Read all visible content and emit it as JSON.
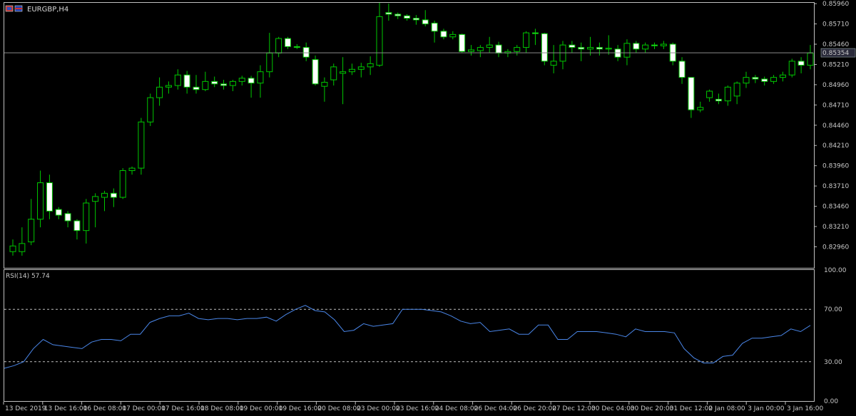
{
  "header": {
    "symbol_label": "EURGBP,H4",
    "icon": "terminal-flag-icons"
  },
  "colors": {
    "bull": "#ffffff",
    "bear": "#ffffff",
    "wick": "#00c800",
    "rsi_line": "#4a86e8",
    "bid_line": "#8a8a8a",
    "grid": "#c0c0c0",
    "frame": "#c0c0c0",
    "bid_box": "#2b2b3b"
  },
  "chart_data": [
    {
      "type": "candlestick",
      "title": "EURGBP,H4",
      "ylim": [
        0.827,
        0.8597
      ],
      "y_ticks": [
        0.8296,
        0.8321,
        0.8346,
        0.8371,
        0.8396,
        0.8421,
        0.8446,
        0.8471,
        0.8496,
        0.8521,
        0.8546,
        0.8571,
        0.8596
      ],
      "y_tick_labels": [
        "0.82960",
        "0.83210",
        "0.83460",
        "0.83710",
        "0.83960",
        "0.84210",
        "0.84460",
        "0.84710",
        "0.84960",
        "0.85210",
        "0.85460",
        "0.85710",
        "0.85960"
      ],
      "current_price": 0.85354,
      "current_price_label": "0.85354",
      "x_labels": [
        "13 Dec 2019",
        "13 Dec 16:00",
        "16 Dec 08:00",
        "17 Dec 00:00",
        "17 Dec 16:00",
        "18 Dec 08:00",
        "19 Dec 00:00",
        "19 Dec 16:00",
        "20 Dec 08:00",
        "23 Dec 00:00",
        "23 Dec 16:00",
        "24 Dec 08:00",
        "26 Dec 04:00",
        "26 Dec 20:00",
        "27 Dec 12:00",
        "30 Dec 04:00",
        "30 Dec 20:00",
        "31 Dec 12:00",
        "2 Jan 08:00",
        "3 Jan 00:00",
        "3 Jan 16:00"
      ],
      "candles": [
        {
          "o": 0.829,
          "h": 0.8305,
          "l": 0.8285,
          "c": 0.8297
        },
        {
          "o": 0.829,
          "h": 0.832,
          "l": 0.8285,
          "c": 0.83
        },
        {
          "o": 0.8302,
          "h": 0.8355,
          "l": 0.8298,
          "c": 0.833
        },
        {
          "o": 0.833,
          "h": 0.839,
          "l": 0.832,
          "c": 0.8375
        },
        {
          "o": 0.8375,
          "h": 0.8385,
          "l": 0.833,
          "c": 0.834
        },
        {
          "o": 0.8342,
          "h": 0.8345,
          "l": 0.833,
          "c": 0.8335
        },
        {
          "o": 0.8337,
          "h": 0.834,
          "l": 0.832,
          "c": 0.8328
        },
        {
          "o": 0.8328,
          "h": 0.833,
          "l": 0.8305,
          "c": 0.8316
        },
        {
          "o": 0.8316,
          "h": 0.8355,
          "l": 0.83,
          "c": 0.835
        },
        {
          "o": 0.8352,
          "h": 0.8362,
          "l": 0.832,
          "c": 0.8358
        },
        {
          "o": 0.8357,
          "h": 0.8365,
          "l": 0.834,
          "c": 0.8362
        },
        {
          "o": 0.8362,
          "h": 0.8368,
          "l": 0.8345,
          "c": 0.8357
        },
        {
          "o": 0.8357,
          "h": 0.8393,
          "l": 0.8355,
          "c": 0.839
        },
        {
          "o": 0.839,
          "h": 0.8395,
          "l": 0.8385,
          "c": 0.8393
        },
        {
          "o": 0.8393,
          "h": 0.8455,
          "l": 0.8385,
          "c": 0.845
        },
        {
          "o": 0.845,
          "h": 0.8485,
          "l": 0.8445,
          "c": 0.848
        },
        {
          "o": 0.848,
          "h": 0.8505,
          "l": 0.847,
          "c": 0.8493
        },
        {
          "o": 0.8493,
          "h": 0.85,
          "l": 0.8485,
          "c": 0.8495
        },
        {
          "o": 0.8495,
          "h": 0.8515,
          "l": 0.849,
          "c": 0.8508
        },
        {
          "o": 0.8508,
          "h": 0.8513,
          "l": 0.8485,
          "c": 0.8493
        },
        {
          "o": 0.8493,
          "h": 0.8508,
          "l": 0.8485,
          "c": 0.849
        },
        {
          "o": 0.849,
          "h": 0.8512,
          "l": 0.8488,
          "c": 0.85
        },
        {
          "o": 0.85,
          "h": 0.8506,
          "l": 0.8493,
          "c": 0.8497
        },
        {
          "o": 0.8497,
          "h": 0.8502,
          "l": 0.849,
          "c": 0.8495
        },
        {
          "o": 0.8495,
          "h": 0.8502,
          "l": 0.8488,
          "c": 0.85
        },
        {
          "o": 0.85,
          "h": 0.8507,
          "l": 0.8495,
          "c": 0.8504
        },
        {
          "o": 0.8504,
          "h": 0.8507,
          "l": 0.848,
          "c": 0.8498
        },
        {
          "o": 0.8498,
          "h": 0.852,
          "l": 0.848,
          "c": 0.8512
        },
        {
          "o": 0.8512,
          "h": 0.856,
          "l": 0.8505,
          "c": 0.8535
        },
        {
          "o": 0.8535,
          "h": 0.8555,
          "l": 0.853,
          "c": 0.8553
        },
        {
          "o": 0.8553,
          "h": 0.8555,
          "l": 0.854,
          "c": 0.8543
        },
        {
          "o": 0.8543,
          "h": 0.8546,
          "l": 0.854,
          "c": 0.8542
        },
        {
          "o": 0.8542,
          "h": 0.8548,
          "l": 0.8525,
          "c": 0.853
        },
        {
          "o": 0.8527,
          "h": 0.8532,
          "l": 0.8495,
          "c": 0.8497
        },
        {
          "o": 0.8494,
          "h": 0.8505,
          "l": 0.8475,
          "c": 0.8499
        },
        {
          "o": 0.8502,
          "h": 0.8522,
          "l": 0.8495,
          "c": 0.8518
        },
        {
          "o": 0.851,
          "h": 0.853,
          "l": 0.8472,
          "c": 0.8512
        },
        {
          "o": 0.8512,
          "h": 0.8522,
          "l": 0.8508,
          "c": 0.8515
        },
        {
          "o": 0.8515,
          "h": 0.8523,
          "l": 0.8505,
          "c": 0.8518
        },
        {
          "o": 0.8518,
          "h": 0.8531,
          "l": 0.8508,
          "c": 0.8522
        },
        {
          "o": 0.852,
          "h": 0.8597,
          "l": 0.8518,
          "c": 0.858
        },
        {
          "o": 0.8585,
          "h": 0.8596,
          "l": 0.8575,
          "c": 0.8583
        },
        {
          "o": 0.8583,
          "h": 0.8585,
          "l": 0.8577,
          "c": 0.8581
        },
        {
          "o": 0.8581,
          "h": 0.8583,
          "l": 0.8575,
          "c": 0.8578
        },
        {
          "o": 0.8578,
          "h": 0.8582,
          "l": 0.857,
          "c": 0.8576
        },
        {
          "o": 0.8576,
          "h": 0.8588,
          "l": 0.8568,
          "c": 0.8571
        },
        {
          "o": 0.8572,
          "h": 0.8575,
          "l": 0.8548,
          "c": 0.8562
        },
        {
          "o": 0.8562,
          "h": 0.8565,
          "l": 0.8552,
          "c": 0.8555
        },
        {
          "o": 0.8555,
          "h": 0.8562,
          "l": 0.8552,
          "c": 0.8558
        },
        {
          "o": 0.8558,
          "h": 0.8559,
          "l": 0.8535,
          "c": 0.8537
        },
        {
          "o": 0.8537,
          "h": 0.8545,
          "l": 0.8532,
          "c": 0.8539
        },
        {
          "o": 0.8538,
          "h": 0.8545,
          "l": 0.853,
          "c": 0.8542
        },
        {
          "o": 0.8542,
          "h": 0.8555,
          "l": 0.8535,
          "c": 0.8545
        },
        {
          "o": 0.8545,
          "h": 0.8549,
          "l": 0.853,
          "c": 0.8535
        },
        {
          "o": 0.8535,
          "h": 0.854,
          "l": 0.853,
          "c": 0.8537
        },
        {
          "o": 0.8537,
          "h": 0.8545,
          "l": 0.8532,
          "c": 0.8542
        },
        {
          "o": 0.8542,
          "h": 0.8562,
          "l": 0.8535,
          "c": 0.856
        },
        {
          "o": 0.856,
          "h": 0.8565,
          "l": 0.8545,
          "c": 0.8559
        },
        {
          "o": 0.8559,
          "h": 0.856,
          "l": 0.852,
          "c": 0.8525
        },
        {
          "o": 0.852,
          "h": 0.8545,
          "l": 0.851,
          "c": 0.8525
        },
        {
          "o": 0.8525,
          "h": 0.855,
          "l": 0.8515,
          "c": 0.8545
        },
        {
          "o": 0.8545,
          "h": 0.855,
          "l": 0.8535,
          "c": 0.8542
        },
        {
          "o": 0.8542,
          "h": 0.8548,
          "l": 0.8525,
          "c": 0.854
        },
        {
          "o": 0.854,
          "h": 0.8555,
          "l": 0.8532,
          "c": 0.8542
        },
        {
          "o": 0.8542,
          "h": 0.8548,
          "l": 0.8532,
          "c": 0.854
        },
        {
          "o": 0.854,
          "h": 0.8557,
          "l": 0.8533,
          "c": 0.8541
        },
        {
          "o": 0.854,
          "h": 0.8545,
          "l": 0.8525,
          "c": 0.853
        },
        {
          "o": 0.853,
          "h": 0.8552,
          "l": 0.852,
          "c": 0.8547
        },
        {
          "o": 0.8547,
          "h": 0.855,
          "l": 0.8535,
          "c": 0.854
        },
        {
          "o": 0.854,
          "h": 0.8548,
          "l": 0.8535,
          "c": 0.8545
        },
        {
          "o": 0.8545,
          "h": 0.8548,
          "l": 0.854,
          "c": 0.8544
        },
        {
          "o": 0.8544,
          "h": 0.855,
          "l": 0.854,
          "c": 0.8546
        },
        {
          "o": 0.8546,
          "h": 0.8548,
          "l": 0.852,
          "c": 0.8525
        },
        {
          "o": 0.8525,
          "h": 0.853,
          "l": 0.8497,
          "c": 0.8505
        },
        {
          "o": 0.8505,
          "h": 0.8505,
          "l": 0.8455,
          "c": 0.8465
        },
        {
          "o": 0.8465,
          "h": 0.8475,
          "l": 0.8462,
          "c": 0.8468
        },
        {
          "o": 0.848,
          "h": 0.849,
          "l": 0.8475,
          "c": 0.8488
        },
        {
          "o": 0.8478,
          "h": 0.8485,
          "l": 0.8472,
          "c": 0.8476
        },
        {
          "o": 0.8476,
          "h": 0.8495,
          "l": 0.847,
          "c": 0.8493
        },
        {
          "o": 0.8482,
          "h": 0.85,
          "l": 0.8472,
          "c": 0.8498
        },
        {
          "o": 0.8498,
          "h": 0.8512,
          "l": 0.8492,
          "c": 0.8505
        },
        {
          "o": 0.8505,
          "h": 0.8508,
          "l": 0.8498,
          "c": 0.8503
        },
        {
          "o": 0.8503,
          "h": 0.8506,
          "l": 0.8495,
          "c": 0.85
        },
        {
          "o": 0.85,
          "h": 0.8508,
          "l": 0.8497,
          "c": 0.8505
        },
        {
          "o": 0.8505,
          "h": 0.8512,
          "l": 0.85,
          "c": 0.8508
        },
        {
          "o": 0.8508,
          "h": 0.8528,
          "l": 0.8505,
          "c": 0.8525
        },
        {
          "o": 0.8525,
          "h": 0.853,
          "l": 0.851,
          "c": 0.852
        },
        {
          "o": 0.852,
          "h": 0.8545,
          "l": 0.8515,
          "c": 0.8535
        }
      ]
    },
    {
      "type": "line",
      "title": "RSI(14) 57.74",
      "ylim": [
        0,
        100
      ],
      "y_ticks": [
        0,
        30,
        70,
        100
      ],
      "y_tick_labels": [
        "0.00",
        "30.00",
        "70.00",
        "100.00"
      ],
      "levels": [
        30,
        70
      ],
      "series": [
        {
          "values": [
            25,
            27,
            30,
            40,
            47,
            43,
            42,
            41,
            40,
            45,
            47,
            47,
            46,
            51,
            51,
            60,
            63,
            65,
            65,
            67,
            63,
            62,
            63,
            63,
            62,
            63,
            63,
            64,
            61,
            66,
            70,
            73,
            69,
            68,
            62,
            53,
            54,
            59,
            57,
            58,
            59,
            70,
            70,
            70,
            69,
            68,
            65,
            61,
            59,
            60,
            53,
            54,
            55,
            51,
            51,
            58,
            58,
            47,
            47,
            53,
            53,
            53,
            52,
            51,
            49,
            55,
            53,
            53,
            53,
            52,
            40,
            33,
            29,
            29,
            34,
            35,
            44,
            48,
            48,
            49,
            50,
            55,
            53,
            57.74
          ]
        }
      ]
    }
  ]
}
